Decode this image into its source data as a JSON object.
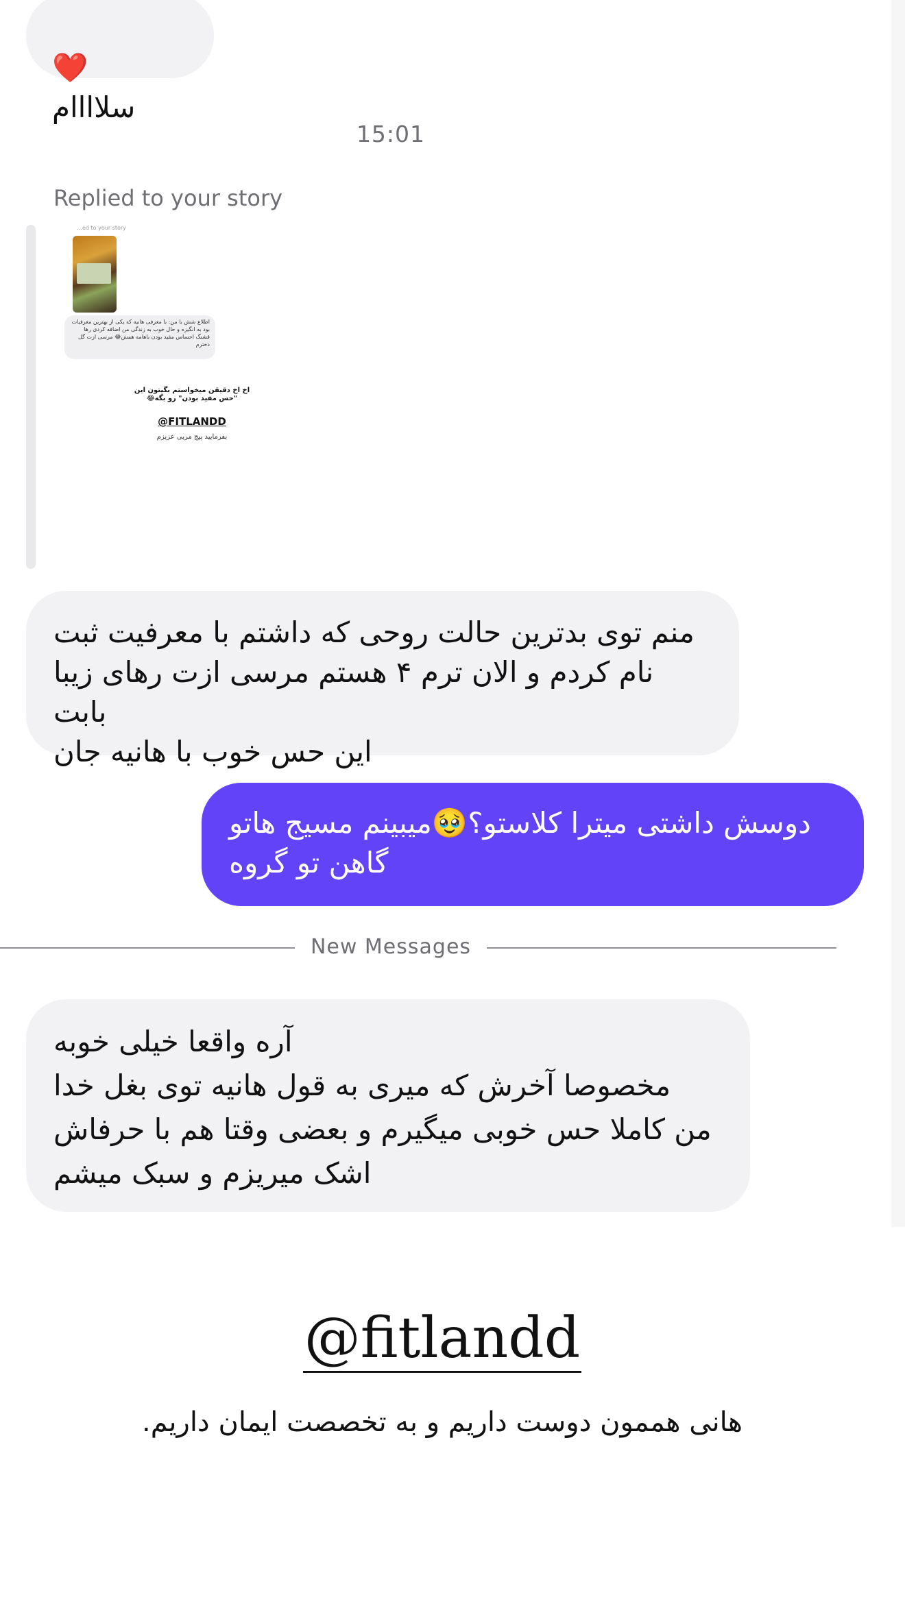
{
  "messages": {
    "top": {
      "text": "سلاااام",
      "emoji": "❤️"
    },
    "timestamp": "15:01",
    "reply_label": "Replied to your story",
    "story": {
      "small_label": "…ed to your story",
      "quote": "اطلاع شش با من: با معرفی هانیه که یکی از بهترین معرفیات بود به انگیزه و حال خوب به زندگی من اضافه کردی رها قشنگ احساس مفید بودن باهامه همش😂 مرسی ازت گل دخترم",
      "caption": "اخ اخ دقیقن میخواستم بگیتون این \"حس مفید بودن\" رو بگه😂",
      "handle": "@FITLANDD",
      "sub": "بفرمایید پیج مربی عزیزم"
    },
    "incoming_1": "منم توی بدترین حالت روحی که داشتم با معرفیت ثبت\nنام کردم و الان ترم ۴ هستم مرسی ازت رهای زیبا بابت\nاین حس خوب با هانیه جان",
    "outgoing_1": "دوسش داشتی میترا کلاستو؟🥹میبینم مسیج هاتو\nگاهن تو گروه",
    "new_messages_label": "New Messages",
    "incoming_2": "آره واقعا خیلی خوبه\nمخصوصا آخرش که میری به قول هانیه توی بغل خدا\nمن کاملا حس خوبی میگیرم و بعضی وقتا هم با حرفاش\nاشک میریزم و سبک میشم"
  },
  "watermark": {
    "handle": "@fitlandd",
    "tagline": "هانی هممون دوست داریم و به تخصصت ایمان داریم."
  },
  "colors": {
    "incoming_bubble": "#f2f2f4",
    "outgoing_bubble": "#6343f7",
    "meta_text": "#6e6e73"
  }
}
